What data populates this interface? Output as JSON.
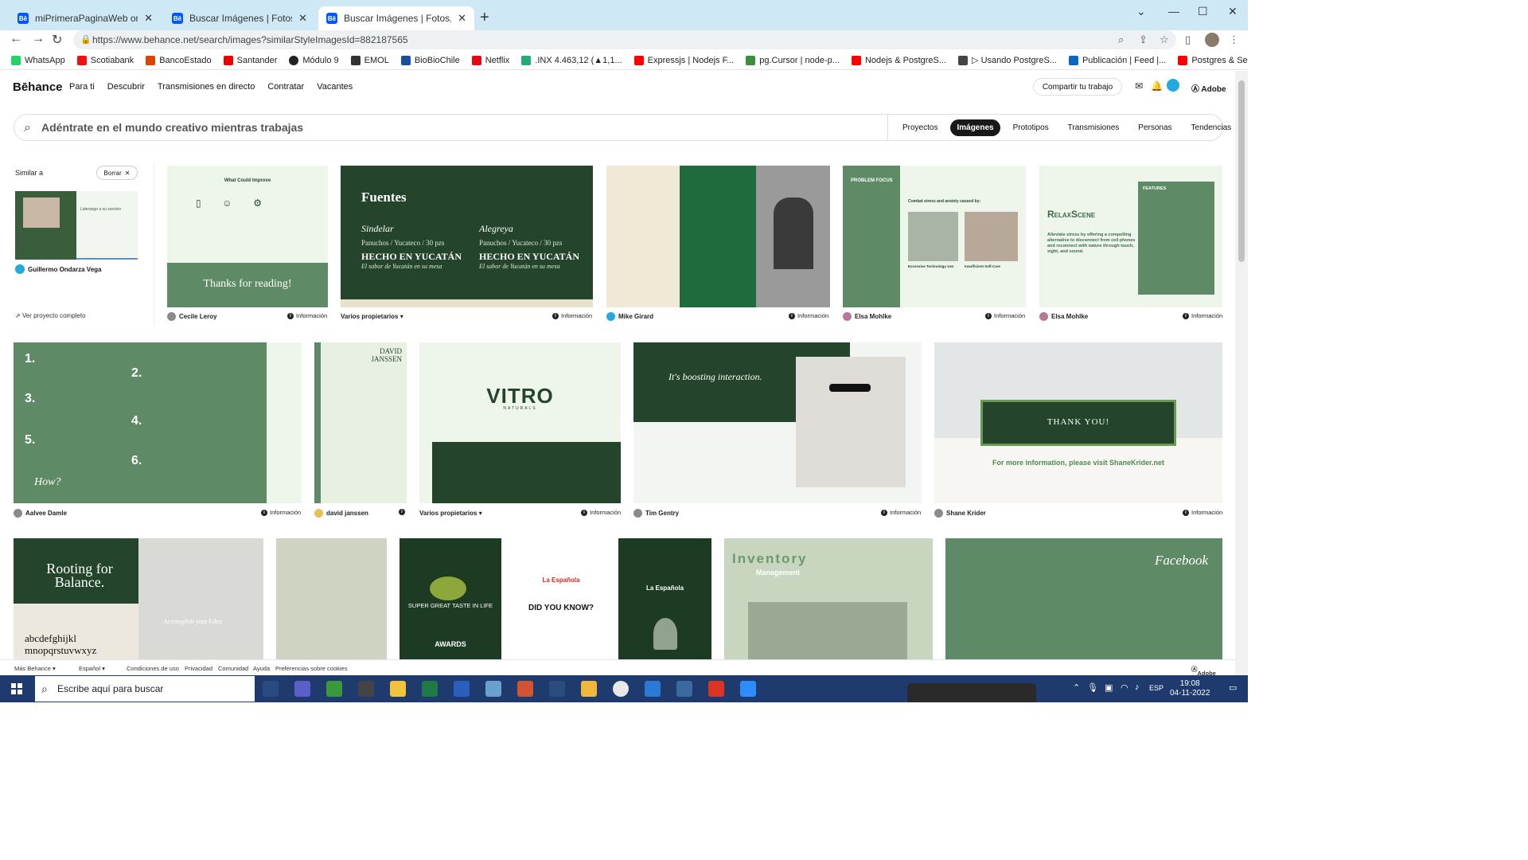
{
  "browser": {
    "tabs": [
      {
        "title": "miPrimeraPaginaWeb on Behance",
        "active": false
      },
      {
        "title": "Buscar Imágenes | Fotos, vídeos,",
        "active": false
      },
      {
        "title": "Buscar Imágenes | Fotos, vídeos,",
        "active": true
      }
    ],
    "url": "https://www.behance.net/search/images?similarStyleImagesId=882187565",
    "bookmarks": [
      "WhatsApp",
      "Scotiabank",
      "BancoEstado",
      "Santander",
      "Módulo 9",
      "EMOL",
      "BioBioChile",
      "Netflix",
      ".INX 4.463,12 (▲1,1...",
      "Expressjs | Nodejs F...",
      "pg.Cursor | node-p...",
      "Nodejs & PostgreS...",
      "▷ Usando PostgreS...",
      "Publicación | Feed |...",
      "Postgres & Sequeli..."
    ]
  },
  "header": {
    "logo": "Bēhance",
    "nav": [
      "Para ti",
      "Descubrir",
      "Transmisiones en directo",
      "Contratar",
      "Vacantes"
    ],
    "share_label": "Compartir tu trabajo",
    "adobe": "Adobe"
  },
  "search": {
    "placeholder": "Adéntrate en el mundo creativo mientras trabajas",
    "tabs": [
      {
        "label": "Proyectos",
        "active": false
      },
      {
        "label": "Imágenes",
        "active": true
      },
      {
        "label": "Prototipos",
        "active": false
      },
      {
        "label": "Transmisiones",
        "active": false
      },
      {
        "label": "Personas",
        "active": false
      },
      {
        "label": "Tendencias",
        "active": false
      }
    ]
  },
  "similar": {
    "label": "Similar a",
    "clear_label": "Borrar",
    "owner": "Guillermo Ondarza Vega",
    "view_project": "Ver proyecto completo",
    "thumb_title": "Liderazgo a su servicio"
  },
  "info_label": "Información",
  "varios_label": "Varios propietarios",
  "cards_text": {
    "c1_title": "What Could Improve",
    "c1_thanks": "Thanks for reading!",
    "c2_title": "Fuentes",
    "c2_f1": "Sindelar",
    "c2_f2": "Alegreya",
    "c2_sub": "Panuchos / Yucateco / 30 pzs",
    "c2_big": "HECHO EN YUCATÁN",
    "c2_tag": "El sabor de Yucatán en su mesa",
    "c4_head": "PROBLEM FOCUS",
    "c4_q": "Combat stress and anxiety caused by:",
    "c4_a": "Excessive Technology Use",
    "c4_b": "Insufficient Self-Care",
    "c5_title": "RelaxScene",
    "c5_body": "Alleviate stress by offering a compelling alternative to disconnect from cell phones and reconnect with nature through touch, sight, and sound.",
    "c5_feat": "FEATURES",
    "r2_howq": "How?",
    "r2_dj": "DAVID JANSSEN",
    "r2_vitro": "VITRO",
    "r2_vitro_sub": "NATURALS",
    "r2_boost": "It's boosting interaction.",
    "r2_thanks": "THANK YOU!",
    "r2_more": "For more information, please visit ShaneKrider.net",
    "r3_rooting": "Rooting for Balance.",
    "r3_alpha": "abcdefghijkl mnopqrstuvwxyz",
    "r3_eden": "Accomplish your Eden",
    "r3_olive": "SUPER GREAT TASTE IN LIFE",
    "r3_awards": "AWARDS",
    "r3_lae": "La Española",
    "r3_dyk": "DID YOU KNOW?",
    "r3_inv": "Inventory",
    "r3_mgmt": "Management",
    "r3_fb": "Facebook"
  },
  "owners": {
    "r1": [
      "Cecile Leroy",
      "Varios propietarios",
      "Mike Girard",
      "Elsa Mohlke",
      "Elsa Mohlke"
    ],
    "r2": [
      "Aalvee Damle",
      "david janssen",
      "Varios propietarios",
      "Tim Gentry",
      "Shane Krider"
    ]
  },
  "footer": {
    "more": "Más Behance ▾",
    "lang": "Español ▾",
    "links": [
      "Condiciones de uso",
      "Privacidad",
      "Comunidad",
      "Ayuda",
      "Preferencias sobre cookies"
    ],
    "adobe": "Adobe"
  },
  "taskbar": {
    "search_placeholder": "Escribe aquí para buscar",
    "time": "19:08",
    "date": "04-11-2022"
  },
  "colors": {
    "dark_green": "#24452c",
    "mid_green": "#5e8a66",
    "light_green": "#eef5ea",
    "accent_blue": "#0057ff"
  }
}
